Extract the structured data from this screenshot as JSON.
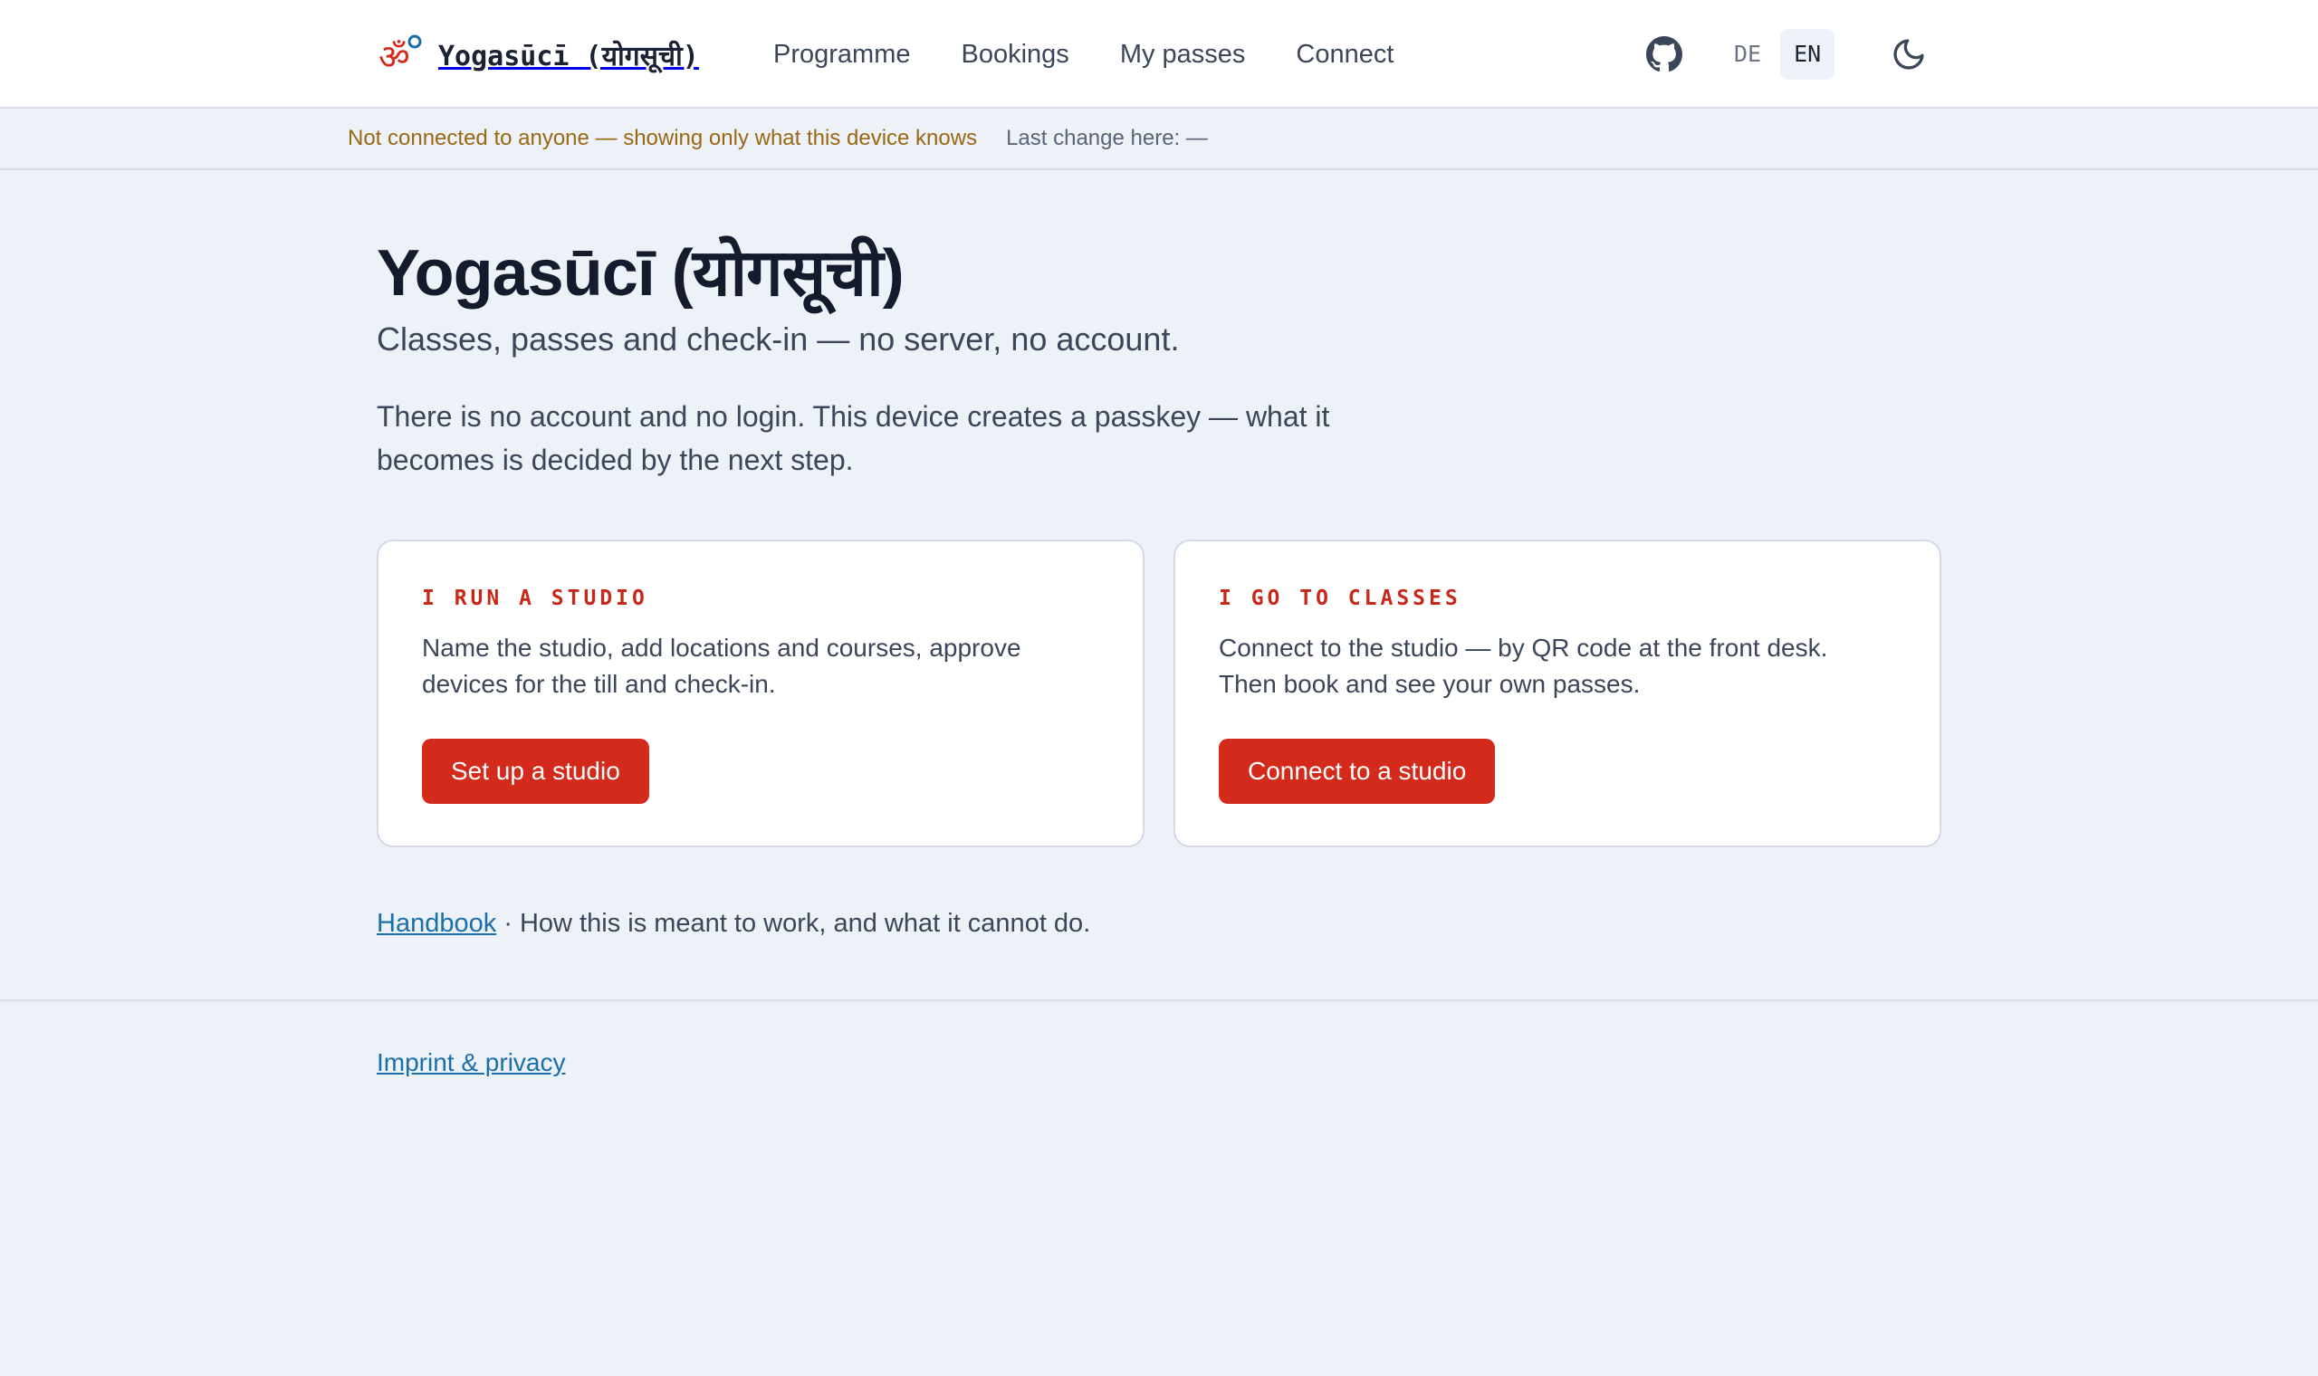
{
  "header": {
    "brand": "Yogasūcī (योगसूची)",
    "logo_icon": "om-icon",
    "nav": [
      {
        "label": "Programme"
      },
      {
        "label": "Bookings"
      },
      {
        "label": "My passes"
      },
      {
        "label": "Connect"
      }
    ],
    "github_icon": "github-icon",
    "languages": [
      {
        "code": "DE",
        "active": false
      },
      {
        "code": "EN",
        "active": true
      }
    ],
    "theme_icon": "moon-icon"
  },
  "status": {
    "connection": "Not connected to anyone — showing only what this device knows",
    "last_change": "Last change here: —"
  },
  "main": {
    "title": "Yogasūcī (योगसूची)",
    "tagline": "Classes, passes and check-in — no server, no account.",
    "intro": "There is no account and no login. This device creates a passkey — what it becomes is decided by the next step.",
    "cards": [
      {
        "kicker": "I RUN A STUDIO",
        "description": "Name the studio, add locations and courses, approve devices for the till and check-in.",
        "button": "Set up a studio"
      },
      {
        "kicker": "I GO TO CLASSES",
        "description": "Connect to the studio — by QR code at the front desk. Then book and see your own passes.",
        "button": "Connect to a studio"
      }
    ],
    "handbook_link": "Handbook",
    "handbook_text": " · How this is meant to work, and what it cannot do."
  },
  "footer": {
    "imprint_link": "Imprint & privacy"
  },
  "colors": {
    "accent": "#d42a1b",
    "kicker": "#c8281a",
    "link": "#1b6fa8",
    "offline": "#9b6712",
    "background": "#edf1f8"
  }
}
